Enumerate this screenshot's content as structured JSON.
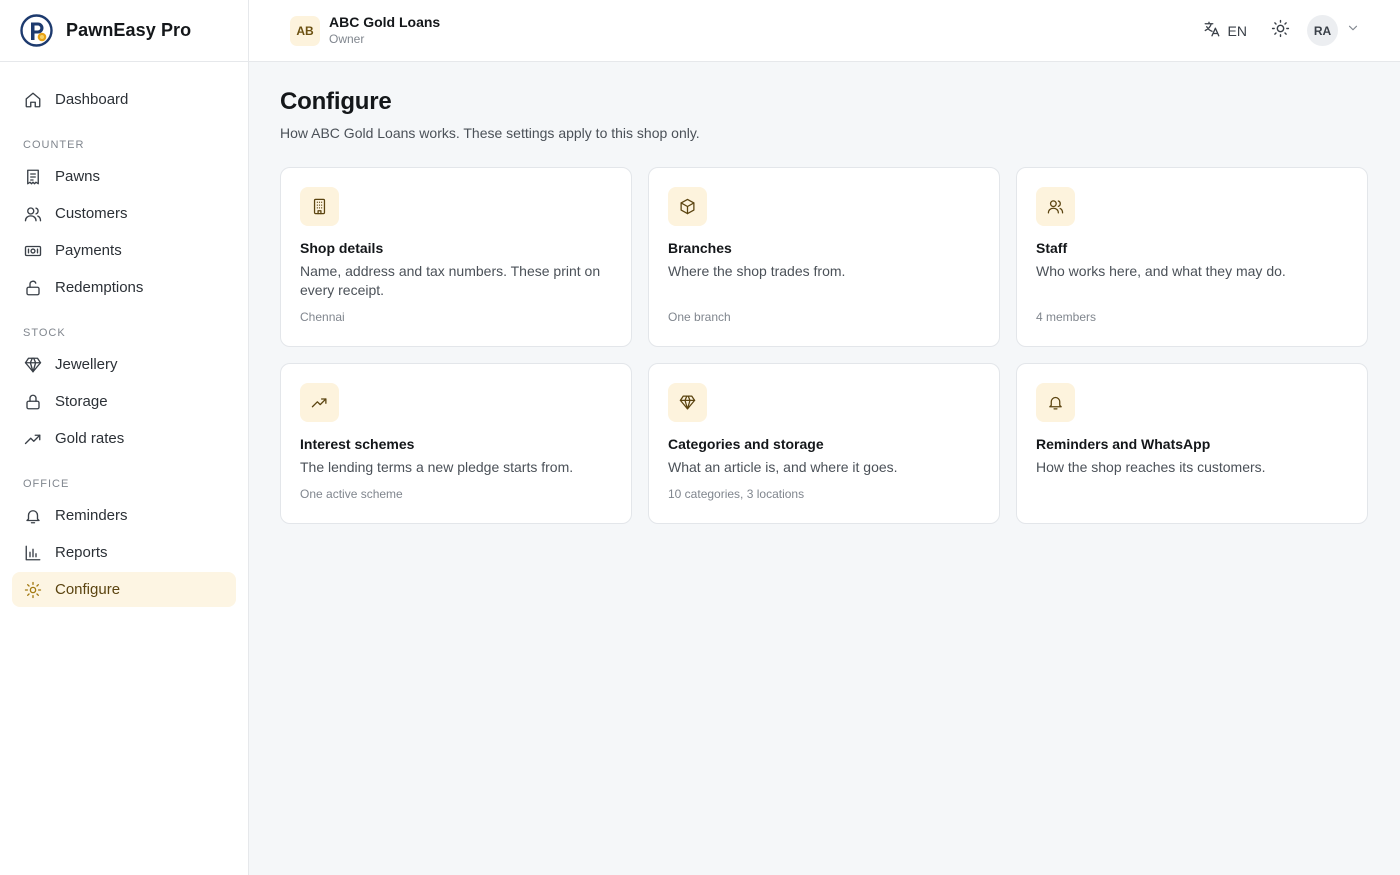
{
  "brand": {
    "name": "PawnEasy Pro",
    "logo_icon": "pawneasy-logo-icon"
  },
  "sidebar": {
    "top_items": [
      {
        "label": "Dashboard",
        "icon": "home-icon"
      }
    ],
    "sections": [
      {
        "label": "COUNTER",
        "items": [
          {
            "label": "Pawns",
            "icon": "receipt-icon"
          },
          {
            "label": "Customers",
            "icon": "users-icon"
          },
          {
            "label": "Payments",
            "icon": "banknote-icon"
          },
          {
            "label": "Redemptions",
            "icon": "unlock-icon"
          }
        ]
      },
      {
        "label": "STOCK",
        "items": [
          {
            "label": "Jewellery",
            "icon": "gem-icon"
          },
          {
            "label": "Storage",
            "icon": "lock-icon"
          },
          {
            "label": "Gold rates",
            "icon": "trending-up-icon"
          }
        ]
      },
      {
        "label": "OFFICE",
        "items": [
          {
            "label": "Reminders",
            "icon": "bell-icon"
          },
          {
            "label": "Reports",
            "icon": "bar-chart-icon"
          },
          {
            "label": "Configure",
            "icon": "sun-gear-icon",
            "active": true
          }
        ]
      }
    ]
  },
  "topbar": {
    "shop_initials": "AB",
    "shop_name": "ABC Gold Loans",
    "shop_role": "Owner",
    "language": "EN",
    "user_initials": "RA"
  },
  "page": {
    "title": "Configure",
    "subtitle": "How ABC Gold Loans works. These settings apply to this shop only."
  },
  "cards": [
    {
      "title": "Shop details",
      "description": "Name, address and tax numbers. These print on every receipt.",
      "meta": "Chennai",
      "icon": "building-icon"
    },
    {
      "title": "Branches",
      "description": "Where the shop trades from.",
      "meta": "One branch",
      "icon": "box-icon"
    },
    {
      "title": "Staff",
      "description": "Who works here, and what they may do.",
      "meta": "4 members",
      "icon": "users-icon"
    },
    {
      "title": "Interest schemes",
      "description": "The lending terms a new pledge starts from.",
      "meta": "One active scheme",
      "icon": "trending-up-icon"
    },
    {
      "title": "Categories and storage",
      "description": "What an article is, and where it goes.",
      "meta": "10 categories, 3 locations",
      "icon": "gem-icon"
    },
    {
      "title": "Reminders and WhatsApp",
      "description": "How the shop reaches its customers.",
      "meta": "",
      "icon": "bell-icon"
    }
  ],
  "colors": {
    "accent": "#a37a12",
    "accent_bg": "#fdf3dd",
    "active_bg": "#fdf5e3"
  }
}
